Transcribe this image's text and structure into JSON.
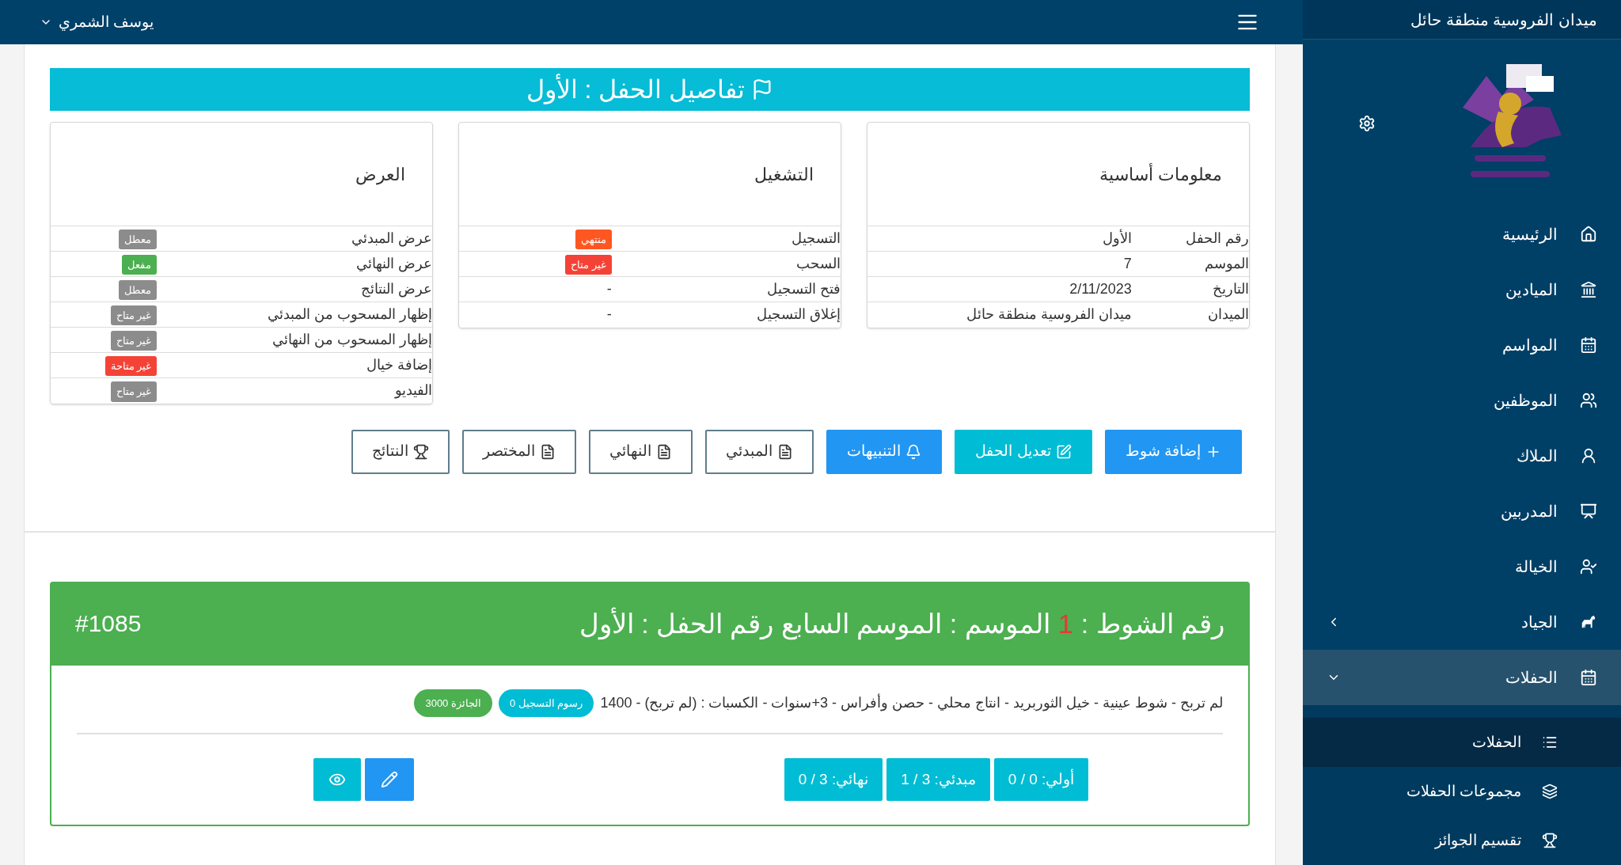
{
  "sidebar": {
    "title": "ميدان الفروسية منطقة حائل",
    "items": [
      {
        "label": "الرئيسية",
        "kind": "link"
      },
      {
        "label": "الميادين",
        "kind": "link"
      },
      {
        "label": "المواسم",
        "kind": "link"
      },
      {
        "label": "الموظفين",
        "kind": "link"
      },
      {
        "label": "الملاك",
        "kind": "link"
      },
      {
        "label": "المدربين",
        "kind": "link"
      },
      {
        "label": "الخيالة",
        "kind": "link"
      },
      {
        "label": "الجياد",
        "kind": "group",
        "expanded": false,
        "selected": false
      },
      {
        "label": "الحفلات",
        "kind": "group",
        "expanded": true,
        "selected": true,
        "children": [
          {
            "label": "الحفلات",
            "selected": true
          },
          {
            "label": "مجموعات الحفلات",
            "selected": false
          },
          {
            "label": "تقسيم الجوائز",
            "selected": false
          }
        ]
      }
    ]
  },
  "topbar": {
    "user": "يوسف الشمري"
  },
  "page_title": "تفاصيل الحفل : الأول",
  "cards": [
    {
      "title": "معلومات أساسية",
      "rows": [
        {
          "label": "رقم الحفل",
          "kind": "text",
          "value": "الأول"
        },
        {
          "label": "الموسم",
          "kind": "text",
          "value": "7"
        },
        {
          "label": "التاريخ",
          "kind": "text",
          "value": "2/11/2023"
        },
        {
          "label": "الميدان",
          "kind": "text",
          "value": "ميدان الفروسية منطقة حائل"
        }
      ]
    },
    {
      "title": "التشغيل",
      "rows": [
        {
          "label": "التسجيل",
          "kind": "badge",
          "value": "منتهي",
          "color": "#ff5722"
        },
        {
          "label": "السحب",
          "kind": "badge",
          "value": "غير متاح",
          "color": "#f44336"
        },
        {
          "label": "فتح التسجيل",
          "kind": "text",
          "value": "-"
        },
        {
          "label": "إغلاق التسجيل",
          "kind": "text",
          "value": "-"
        }
      ]
    },
    {
      "title": "العرض",
      "rows": [
        {
          "label": "عرض المبدئي",
          "kind": "badge",
          "value": "معطل",
          "color": "#8c8c8c"
        },
        {
          "label": "عرض النهائي",
          "kind": "badge",
          "value": "مفعل",
          "color": "#4caf50"
        },
        {
          "label": "عرض النتائج",
          "kind": "badge",
          "value": "معطل",
          "color": "#8c8c8c"
        },
        {
          "label": "إظهار المسحوب من المبدئي",
          "kind": "badge",
          "value": "غير متاح",
          "color": "#8c8c8c"
        },
        {
          "label": "إظهار المسحوب من النهائي",
          "kind": "badge",
          "value": "غير متاح",
          "color": "#8c8c8c"
        },
        {
          "label": "إضافة خيال",
          "kind": "badge",
          "value": "غير متاحة",
          "color": "#f44336"
        },
        {
          "label": "الفيديو",
          "kind": "badge",
          "value": "غير متاح",
          "color": "#8c8c8c"
        }
      ]
    }
  ],
  "actions": [
    {
      "label": "إضافة شوط",
      "kind": "primary"
    },
    {
      "label": "تعديل الحفل",
      "kind": "info"
    },
    {
      "label": "التنبيهات",
      "kind": "primary"
    },
    {
      "label": "المبدئي",
      "kind": "outline"
    },
    {
      "label": "النهائي",
      "kind": "outline"
    },
    {
      "label": "المختصر",
      "kind": "outline"
    },
    {
      "label": "النتائج",
      "kind": "outline"
    }
  ],
  "race": {
    "title_prefix": "رقم الشوط :",
    "number": "1",
    "title_suffix": "الموسم : الموسم السابع رقم الحفل : الأول",
    "id": "#1085",
    "description": "لم تربح - شوط عينية - خيل الثوربريد - انتاج محلي - حصن وأفراس - 3+سنوات - الكسبات : (لم تربح) - 1400",
    "badges": [
      {
        "label": "رسوم التسجيل 0",
        "color": "#00bcd4"
      },
      {
        "label": "الجائزة 3000",
        "color": "#4caf50"
      }
    ],
    "counts": [
      "أولي: 0 / 0",
      "مبدئي: 3 / 1",
      "نهائي: 3 / 0"
    ]
  }
}
